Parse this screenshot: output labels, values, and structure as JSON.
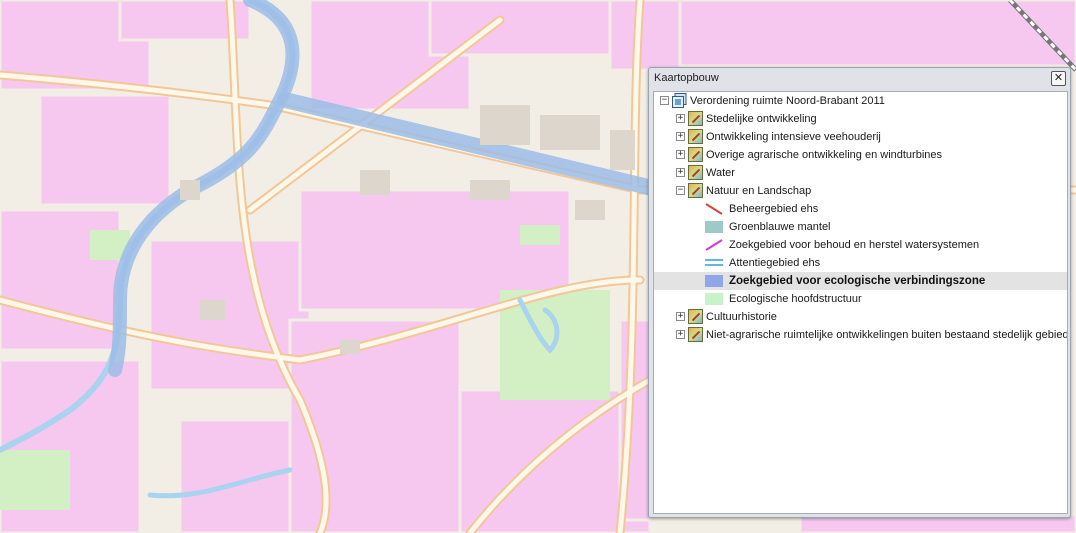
{
  "panel": {
    "title": "Kaartopbouw",
    "close_glyph": "✕"
  },
  "tree": {
    "root_label": "Verordening ruimte Noord-Brabant 2011",
    "groups": [
      {
        "label": "Stedelijke ontwikkeling",
        "expanded": false
      },
      {
        "label": "Ontwikkeling intensieve veehouderij",
        "expanded": false
      },
      {
        "label": "Overige agrarische ontwikkeling en windturbines",
        "expanded": false
      },
      {
        "label": "Water",
        "expanded": false
      },
      {
        "label": "Natuur en Landschap",
        "expanded": true
      },
      {
        "label": "Cultuurhistorie",
        "expanded": false
      },
      {
        "label": "Niet-agrarische ruimtelijke ontwikkelingen buiten bestaand stedelijk gebied",
        "expanded": false
      }
    ],
    "legend_items": [
      {
        "label": "Beheergebied ehs",
        "symbol": "red-diagonal-line",
        "color": "#d9453a"
      },
      {
        "label": "Groenblauwe mantel",
        "symbol": "teal-fill",
        "color": "#9ec9c9"
      },
      {
        "label": "Zoekgebied voor behoud en herstel watersystemen",
        "symbol": "magenta-diagonal-line",
        "color": "#d23ad6"
      },
      {
        "label": "Attentiegebied ehs",
        "symbol": "blue-double-line",
        "color": "#2f9fd6"
      },
      {
        "label": "Zoekgebied voor ecologische verbindingszone",
        "symbol": "blue-fill",
        "color": "#8fa6e8",
        "selected": true
      },
      {
        "label": "Ecologische hoofdstructuur",
        "symbol": "light-green-fill",
        "color": "#c8f2c8"
      }
    ]
  },
  "icons": {
    "collapsed": "+",
    "expanded": "−",
    "layer": "layer-icon",
    "root": "map-service-icon"
  },
  "colors": {
    "map_background": "#f2eee6",
    "urban_pink": "#f6c8f0",
    "road": "#fff8e8",
    "road_edge": "#f1c79a",
    "water": "#a9d3ef",
    "green": "#d2f0c4",
    "ecological_zone": "#9cbce6"
  }
}
